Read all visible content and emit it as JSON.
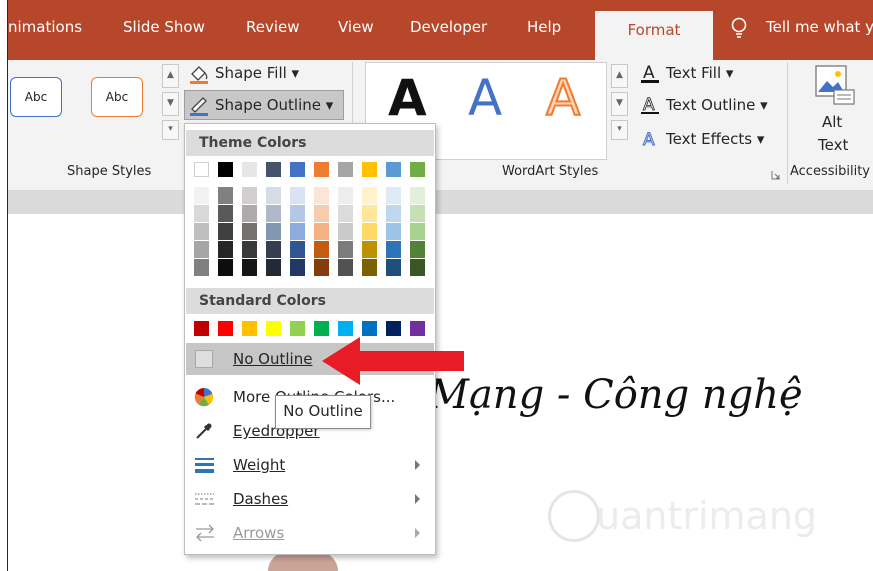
{
  "colors": {
    "accent": "#b7472a",
    "arrow": "#e81c24"
  },
  "tabs": {
    "animations": "nimations",
    "slideshow": "Slide Show",
    "review": "Review",
    "view": "View",
    "developer": "Developer",
    "help": "Help",
    "format": "Format",
    "tellme": "Tell me what y"
  },
  "ribbon": {
    "shape_styles": {
      "sample1": "Abc",
      "sample2": "Abc",
      "label": "Shape Styles"
    },
    "shape_fill": "Shape Fill",
    "shape_outline": "Shape Outline",
    "wordart": {
      "glyph": "A",
      "label": "WordArt Styles"
    },
    "text_fill": "Text Fill",
    "text_outline": "Text Outline",
    "text_effects": "Text Effects",
    "alt_text_1": "Alt",
    "alt_text_2": "Text",
    "accessibility": "Accessibility"
  },
  "menu": {
    "theme_colors_header": "Theme Colors",
    "standard_colors_header": "Standard Colors",
    "theme_top_row": [
      "#ffffff",
      "#000000",
      "#e7e6e6",
      "#44546a",
      "#4472c4",
      "#ed7d31",
      "#a5a5a5",
      "#ffc000",
      "#5b9bd5",
      "#70ad47"
    ],
    "theme_shades": [
      [
        "#f2f2f2",
        "#d9d9d9",
        "#bfbfbf",
        "#a6a6a6",
        "#808080"
      ],
      [
        "#808080",
        "#595959",
        "#404040",
        "#262626",
        "#0d0d0d"
      ],
      [
        "#d0cece",
        "#aeaaaa",
        "#757171",
        "#3a3838",
        "#171616"
      ],
      [
        "#d6dce5",
        "#adb9ca",
        "#8497b0",
        "#333f50",
        "#222a35"
      ],
      [
        "#dae3f3",
        "#b4c7e7",
        "#8faadc",
        "#2f5597",
        "#203864"
      ],
      [
        "#fbe5d6",
        "#f8cbad",
        "#f4b183",
        "#c55a11",
        "#843c0c"
      ],
      [
        "#ededed",
        "#dbdbdb",
        "#c9c9c9",
        "#7b7b7b",
        "#525252"
      ],
      [
        "#fff2cc",
        "#ffe699",
        "#ffd966",
        "#bf9000",
        "#7f6000"
      ],
      [
        "#deebf7",
        "#bdd7ee",
        "#9dc3e6",
        "#2e75b6",
        "#1f4e79"
      ],
      [
        "#e2f0d9",
        "#c5e0b4",
        "#a9d18e",
        "#548235",
        "#385723"
      ]
    ],
    "standard_colors": [
      "#c00000",
      "#ff0000",
      "#ffc000",
      "#ffff00",
      "#92d050",
      "#00b050",
      "#00b0f0",
      "#0070c0",
      "#002060",
      "#7030a0"
    ],
    "no_outline": "No Outline",
    "more_colors": "More Outline Colors...",
    "eyedropper": "Eyedropper",
    "weight": "Weight",
    "dashes": "Dashes",
    "arrows": "Arrows"
  },
  "tooltip": "No Outline",
  "canvas": {
    "text": "Mạng - Công nghệ",
    "watermark": "uantrimang"
  }
}
